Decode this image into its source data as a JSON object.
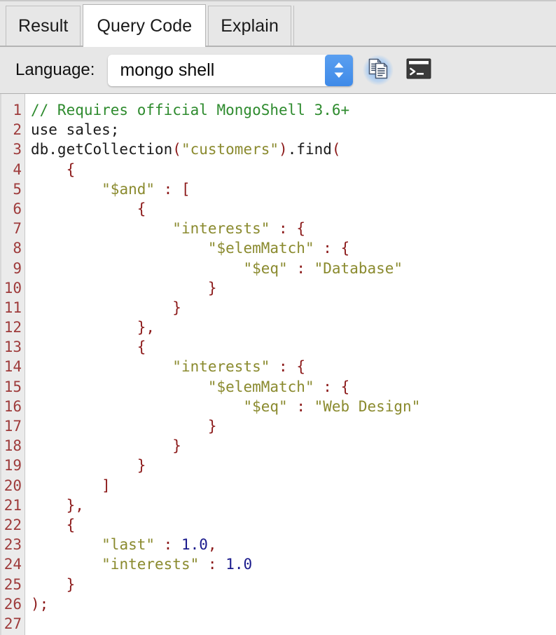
{
  "tabs": [
    {
      "label": "Result",
      "active": false,
      "name": "tab-result"
    },
    {
      "label": "Query Code",
      "active": true,
      "name": "tab-query-code"
    },
    {
      "label": "Explain",
      "active": false,
      "name": "tab-explain"
    }
  ],
  "toolbar": {
    "language_label": "Language:",
    "language_value": "mongo shell",
    "language_placeholder": "mongo shell",
    "language_options": [
      "mongo shell"
    ],
    "copy_icon": "copy-icon",
    "shell_icon": "terminal-icon",
    "stepper_icon": "updown-stepper-icon",
    "accent_color": "#3f8ae8"
  },
  "editor": {
    "line_numbers": [
      "1",
      "2",
      "3",
      "4",
      "5",
      "6",
      "7",
      "8",
      "9",
      "10",
      "11",
      "12",
      "13",
      "14",
      "15",
      "16",
      "17",
      "18",
      "19",
      "20",
      "21",
      "22",
      "23",
      "24",
      "25",
      "26",
      "27"
    ],
    "colors": {
      "comment": "#2e8b2e",
      "string": "#8a8a2e",
      "punctuation": "#8c1a1a",
      "number": "#1a1a8c",
      "text": "#1a1a1a",
      "gutter_bg": "#ebebeb",
      "gutter_text": "#9e3b3b",
      "background": "#ffffff"
    },
    "lines": [
      [
        {
          "t": "// Requires official MongoShell 3.6+",
          "c": "com"
        }
      ],
      [
        {
          "t": "use sales;",
          "c": "txt"
        }
      ],
      [
        {
          "t": "db.getCollection",
          "c": "txt"
        },
        {
          "t": "(",
          "c": "pun"
        },
        {
          "t": "\"customers\"",
          "c": "str"
        },
        {
          "t": ")",
          "c": "pun"
        },
        {
          "t": ".find",
          "c": "txt"
        },
        {
          "t": "(",
          "c": "pun"
        }
      ],
      [
        {
          "t": "    ",
          "c": "txt"
        },
        {
          "t": "{",
          "c": "pun"
        }
      ],
      [
        {
          "t": "        ",
          "c": "txt"
        },
        {
          "t": "\"$and\"",
          "c": "str"
        },
        {
          "t": " ",
          "c": "txt"
        },
        {
          "t": ":",
          "c": "pun"
        },
        {
          "t": " ",
          "c": "txt"
        },
        {
          "t": "[",
          "c": "pun"
        }
      ],
      [
        {
          "t": "            ",
          "c": "txt"
        },
        {
          "t": "{",
          "c": "pun"
        }
      ],
      [
        {
          "t": "                ",
          "c": "txt"
        },
        {
          "t": "\"interests\"",
          "c": "str"
        },
        {
          "t": " ",
          "c": "txt"
        },
        {
          "t": ":",
          "c": "pun"
        },
        {
          "t": " ",
          "c": "txt"
        },
        {
          "t": "{",
          "c": "pun"
        }
      ],
      [
        {
          "t": "                    ",
          "c": "txt"
        },
        {
          "t": "\"$elemMatch\"",
          "c": "str"
        },
        {
          "t": " ",
          "c": "txt"
        },
        {
          "t": ":",
          "c": "pun"
        },
        {
          "t": " ",
          "c": "txt"
        },
        {
          "t": "{",
          "c": "pun"
        }
      ],
      [
        {
          "t": "                        ",
          "c": "txt"
        },
        {
          "t": "\"$eq\"",
          "c": "str"
        },
        {
          "t": " ",
          "c": "txt"
        },
        {
          "t": ":",
          "c": "pun"
        },
        {
          "t": " ",
          "c": "txt"
        },
        {
          "t": "\"Database\"",
          "c": "str"
        }
      ],
      [
        {
          "t": "                    ",
          "c": "txt"
        },
        {
          "t": "}",
          "c": "pun"
        }
      ],
      [
        {
          "t": "                ",
          "c": "txt"
        },
        {
          "t": "}",
          "c": "pun"
        }
      ],
      [
        {
          "t": "            ",
          "c": "txt"
        },
        {
          "t": "},",
          "c": "pun"
        }
      ],
      [
        {
          "t": "            ",
          "c": "txt"
        },
        {
          "t": "{",
          "c": "pun"
        }
      ],
      [
        {
          "t": "                ",
          "c": "txt"
        },
        {
          "t": "\"interests\"",
          "c": "str"
        },
        {
          "t": " ",
          "c": "txt"
        },
        {
          "t": ":",
          "c": "pun"
        },
        {
          "t": " ",
          "c": "txt"
        },
        {
          "t": "{",
          "c": "pun"
        }
      ],
      [
        {
          "t": "                    ",
          "c": "txt"
        },
        {
          "t": "\"$elemMatch\"",
          "c": "str"
        },
        {
          "t": " ",
          "c": "txt"
        },
        {
          "t": ":",
          "c": "pun"
        },
        {
          "t": " ",
          "c": "txt"
        },
        {
          "t": "{",
          "c": "pun"
        }
      ],
      [
        {
          "t": "                        ",
          "c": "txt"
        },
        {
          "t": "\"$eq\"",
          "c": "str"
        },
        {
          "t": " ",
          "c": "txt"
        },
        {
          "t": ":",
          "c": "pun"
        },
        {
          "t": " ",
          "c": "txt"
        },
        {
          "t": "\"Web Design\"",
          "c": "str"
        }
      ],
      [
        {
          "t": "                    ",
          "c": "txt"
        },
        {
          "t": "}",
          "c": "pun"
        }
      ],
      [
        {
          "t": "                ",
          "c": "txt"
        },
        {
          "t": "}",
          "c": "pun"
        }
      ],
      [
        {
          "t": "            ",
          "c": "txt"
        },
        {
          "t": "}",
          "c": "pun"
        }
      ],
      [
        {
          "t": "        ",
          "c": "txt"
        },
        {
          "t": "]",
          "c": "pun"
        }
      ],
      [
        {
          "t": "    ",
          "c": "txt"
        },
        {
          "t": "},",
          "c": "pun"
        }
      ],
      [
        {
          "t": "    ",
          "c": "txt"
        },
        {
          "t": "{",
          "c": "pun"
        }
      ],
      [
        {
          "t": "        ",
          "c": "txt"
        },
        {
          "t": "\"last\"",
          "c": "str"
        },
        {
          "t": " ",
          "c": "txt"
        },
        {
          "t": ":",
          "c": "pun"
        },
        {
          "t": " ",
          "c": "txt"
        },
        {
          "t": "1.0",
          "c": "num"
        },
        {
          "t": ",",
          "c": "pun"
        }
      ],
      [
        {
          "t": "        ",
          "c": "txt"
        },
        {
          "t": "\"interests\"",
          "c": "str"
        },
        {
          "t": " ",
          "c": "txt"
        },
        {
          "t": ":",
          "c": "pun"
        },
        {
          "t": " ",
          "c": "txt"
        },
        {
          "t": "1.0",
          "c": "num"
        }
      ],
      [
        {
          "t": "    ",
          "c": "txt"
        },
        {
          "t": "}",
          "c": "pun"
        }
      ],
      [
        {
          "t": ");",
          "c": "pun"
        }
      ],
      []
    ]
  }
}
